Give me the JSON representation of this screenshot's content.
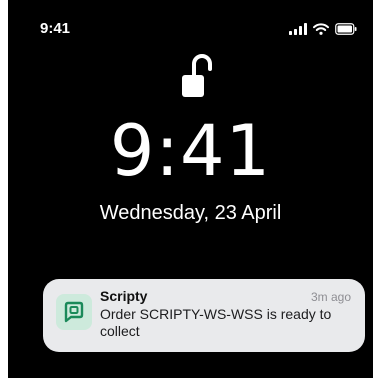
{
  "status_bar": {
    "time": "9:41",
    "icons": [
      "signal-icon",
      "wifi-icon",
      "battery-icon"
    ]
  },
  "lock_screen": {
    "lock_icon": "unlocked-padlock-icon",
    "time": "9:41",
    "date": "Wednesday, 23 April"
  },
  "notification": {
    "app_name": "Scripty",
    "time_ago": "3m ago",
    "message": "Order SCRIPTY-WS-WSS is ready to collect",
    "icon": "scripty-app-icon",
    "icon_color": "#1b8a5a",
    "icon_bg": "#cdeadc"
  },
  "colors": {
    "background": "#000000",
    "text": "#ffffff",
    "card": "#e9eaec"
  }
}
